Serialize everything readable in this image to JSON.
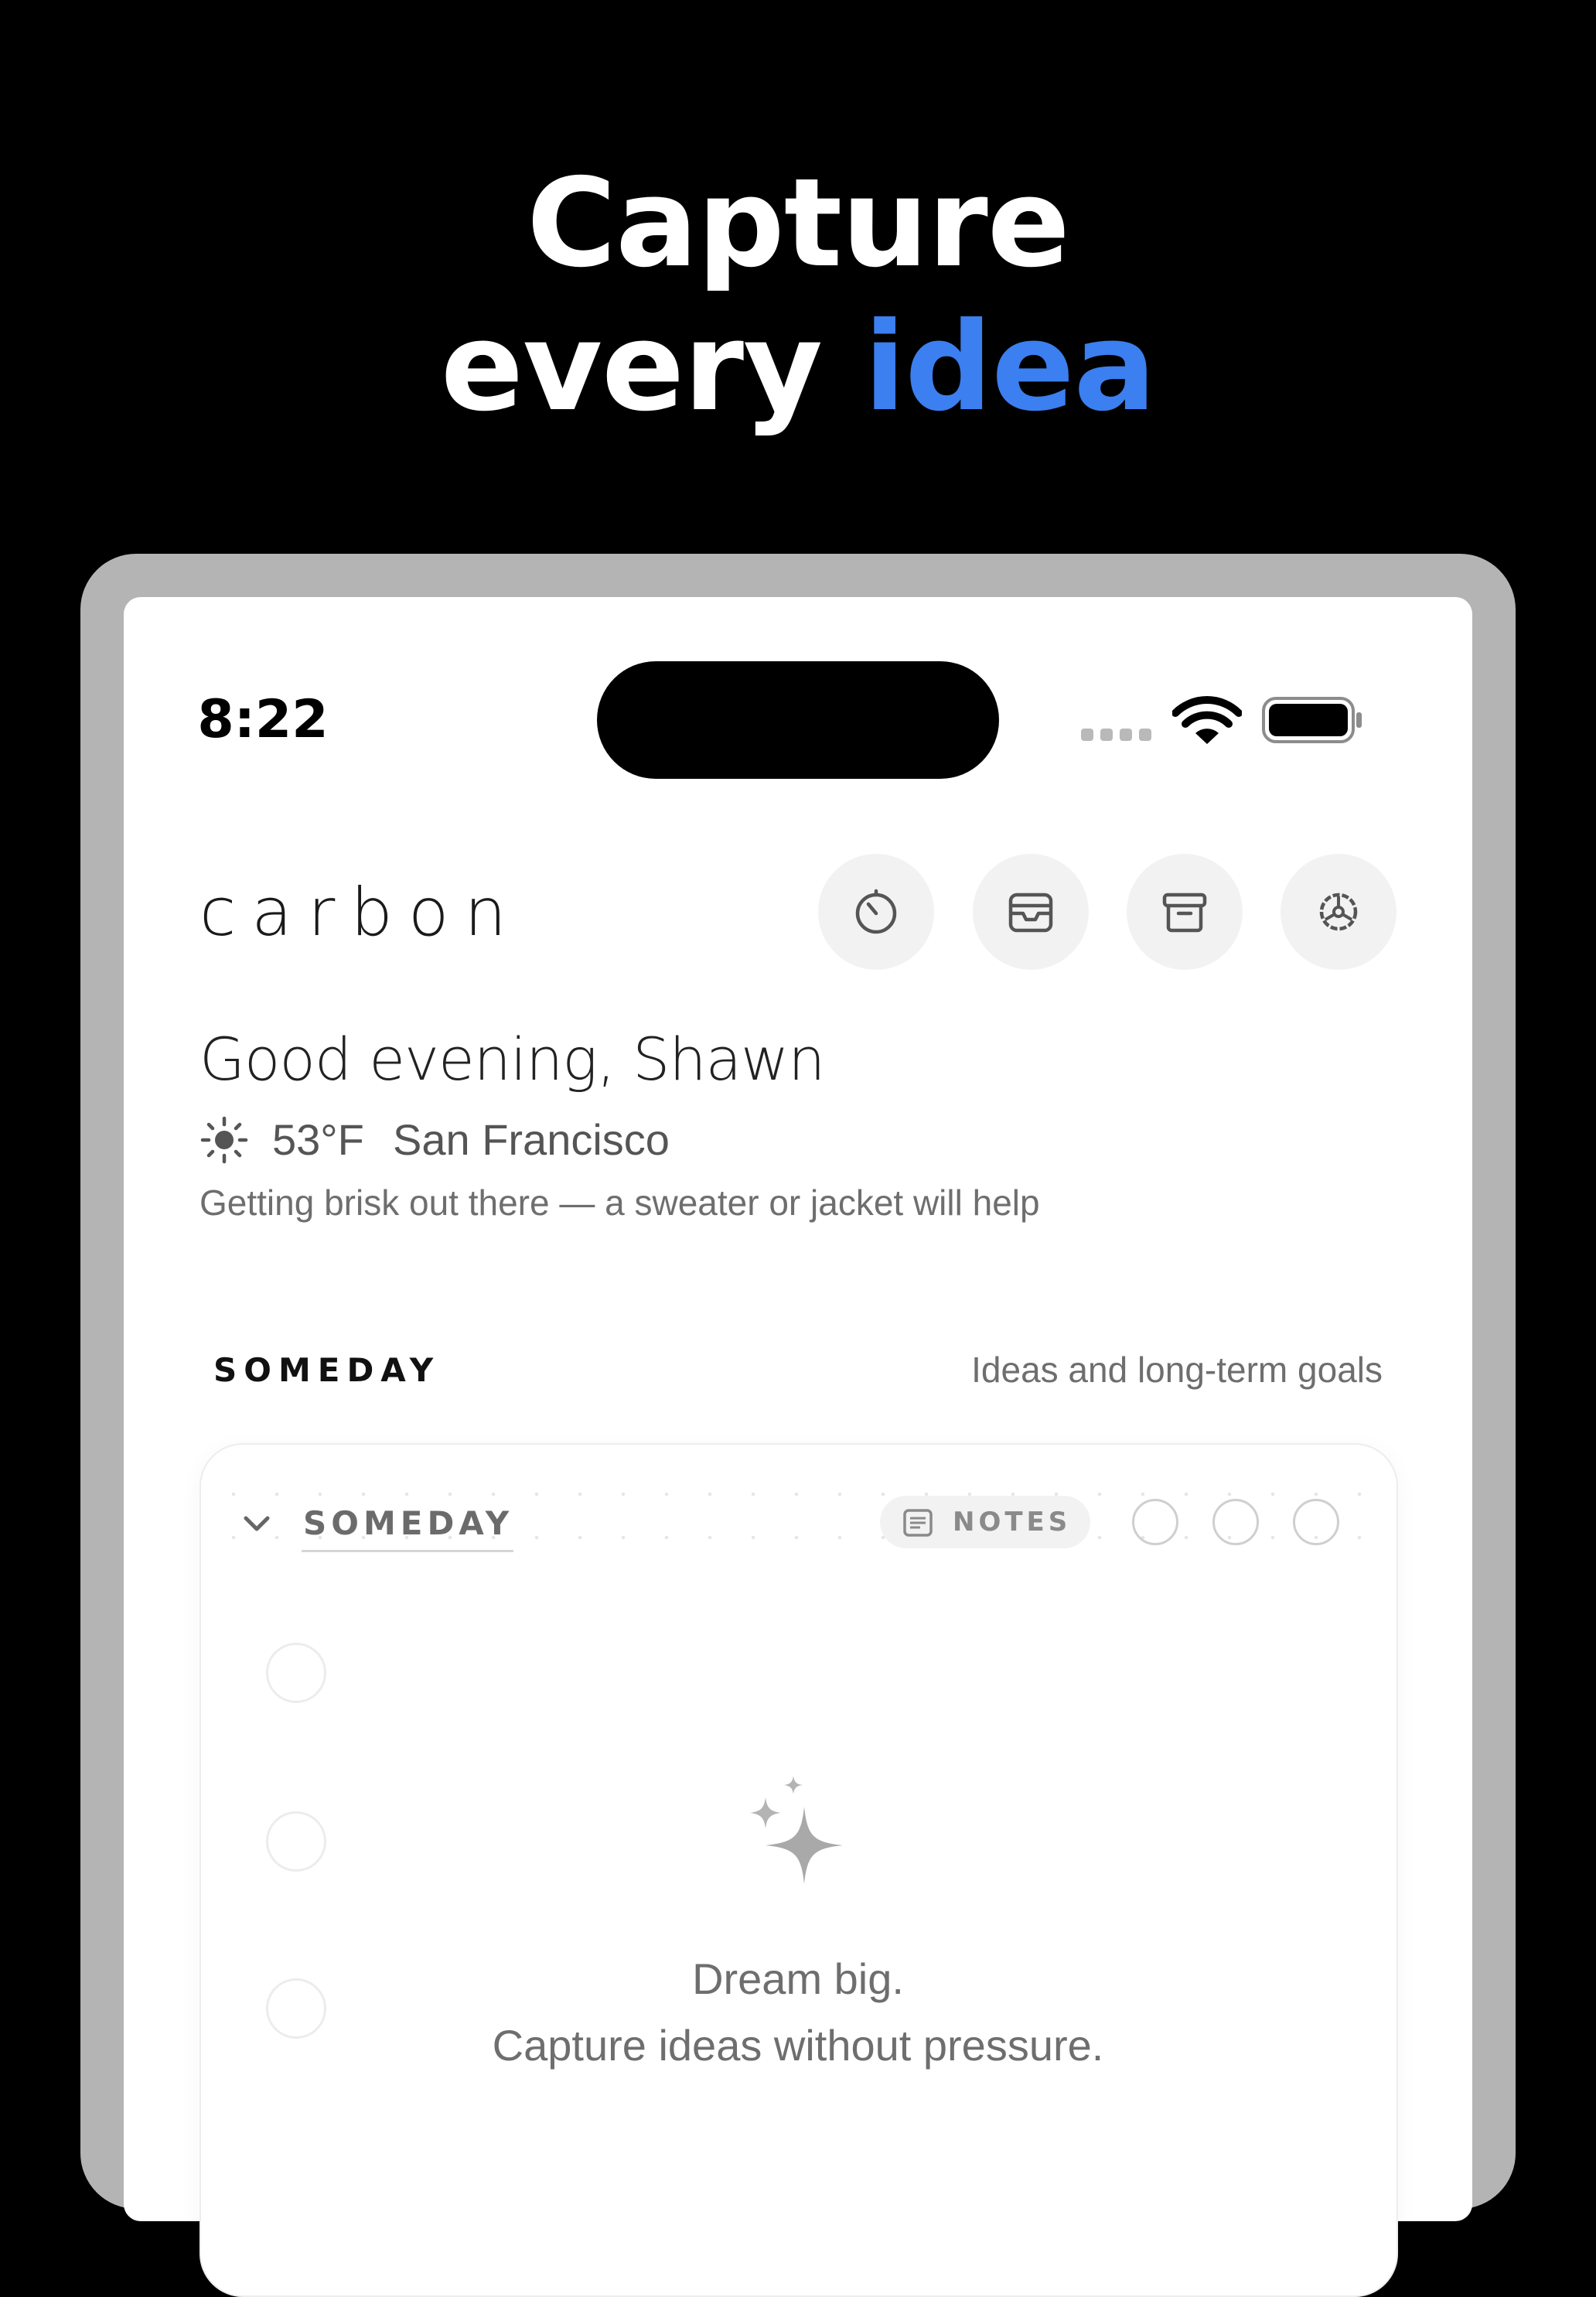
{
  "marketing": {
    "headline_line1": "Capture",
    "headline_line2_part1": "every",
    "headline_line2_accent": "idea",
    "accent_color": "#3B7FF0"
  },
  "status_bar": {
    "time": "8:22",
    "icons": [
      "cellular-signal-icon",
      "wifi-icon",
      "battery-icon"
    ]
  },
  "header": {
    "brand": "carbon",
    "buttons": [
      {
        "name": "timer-icon"
      },
      {
        "name": "inbox-icon"
      },
      {
        "name": "archive-icon"
      },
      {
        "name": "settings-icon"
      }
    ]
  },
  "greeting": {
    "text": "Good evening, Shawn",
    "weather_icon": "sun-icon",
    "temperature": "53°F",
    "city": "San Francisco",
    "tip": "Getting brisk out there — a sweater or jacket will help"
  },
  "section": {
    "title": "SOMEDAY",
    "subtitle": "Ideas and long-term goals"
  },
  "card": {
    "title": "SOMEDAY",
    "notes_label": "NOTES",
    "empty_icon": "sparkle-icon",
    "empty_line1": "Dream big.",
    "empty_line2": "Capture ideas without pressure."
  }
}
